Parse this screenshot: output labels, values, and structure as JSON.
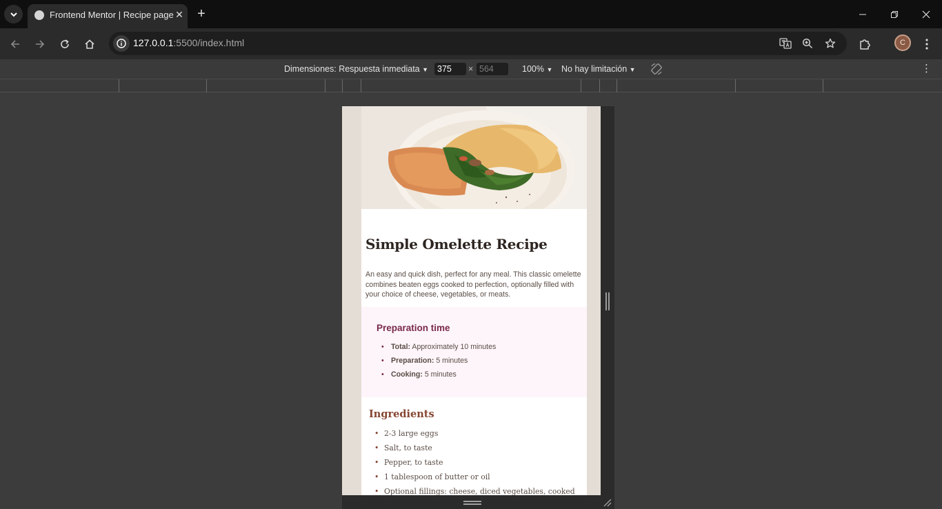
{
  "browser": {
    "tab_title": "Frontend Mentor | Recipe page",
    "url_host": "127.0.0.1",
    "url_rest": ":5500/index.html",
    "profile_initial": "C"
  },
  "devtools": {
    "dimensions_label": "Dimensiones: Respuesta inmediata",
    "width_value": "375",
    "times": "×",
    "height_value": "564",
    "zoom": "100%",
    "throttling": "No hay limitación"
  },
  "recipe": {
    "title": "Simple Omelette Recipe",
    "description": "An easy and quick dish, perfect for any meal. This classic omelette combines beaten eggs cooked to perfection, optionally filled with your choice of cheese, vegetables, or meats.",
    "preparation": {
      "heading": "Preparation time",
      "items": [
        {
          "label": "Total:",
          "value": " Approximately 10 minutes"
        },
        {
          "label": "Preparation:",
          "value": " 5 minutes"
        },
        {
          "label": "Cooking:",
          "value": " 5 minutes"
        }
      ]
    },
    "ingredients": {
      "heading": "Ingredients",
      "items": [
        "2-3 large eggs",
        "Salt, to taste",
        "Pepper, to taste",
        "1 tablespoon of butter or oil",
        "Optional fillings: cheese, diced vegetables, cooked"
      ]
    }
  },
  "colors": {
    "brand_rose": "#7a284b",
    "nutmeg": "#854632",
    "rose_50": "#fdf5fa",
    "stone_100": "#e4ddd6"
  }
}
